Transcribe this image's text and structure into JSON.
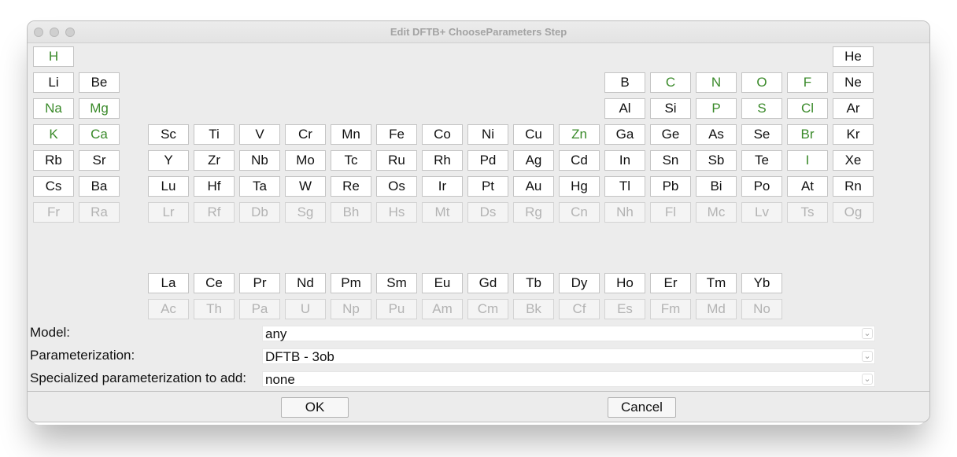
{
  "window": {
    "title": "Edit DFTB+ ChooseParameters Step"
  },
  "colors": {
    "available_element": "#3a8a2a",
    "disabled_element": "#b3b3b3",
    "normal_element": "#111111"
  },
  "periodic_table": {
    "main": [
      [
        "H",
        "",
        "",
        "",
        "",
        "",
        "",
        "",
        "",
        "",
        "",
        "",
        "",
        "",
        "",
        "",
        "",
        "He"
      ],
      [
        "Li",
        "Be",
        "",
        "",
        "",
        "",
        "",
        "",
        "",
        "",
        "",
        "",
        "B",
        "C",
        "N",
        "O",
        "F",
        "Ne"
      ],
      [
        "Na",
        "Mg",
        "",
        "",
        "",
        "",
        "",
        "",
        "",
        "",
        "",
        "",
        "Al",
        "Si",
        "P",
        "S",
        "Cl",
        "Ar"
      ],
      [
        "K",
        "Ca",
        "Sc",
        "Ti",
        "V",
        "Cr",
        "Mn",
        "Fe",
        "Co",
        "Ni",
        "Cu",
        "Zn",
        "Ga",
        "Ge",
        "As",
        "Se",
        "Br",
        "Kr"
      ],
      [
        "Rb",
        "Sr",
        "Y",
        "Zr",
        "Nb",
        "Mo",
        "Tc",
        "Ru",
        "Rh",
        "Pd",
        "Ag",
        "Cd",
        "In",
        "Sn",
        "Sb",
        "Te",
        "I",
        "Xe"
      ],
      [
        "Cs",
        "Ba",
        "Lu",
        "Hf",
        "Ta",
        "W",
        "Re",
        "Os",
        "Ir",
        "Pt",
        "Au",
        "Hg",
        "Tl",
        "Pb",
        "Bi",
        "Po",
        "At",
        "Rn"
      ],
      [
        "Fr",
        "Ra",
        "Lr",
        "Rf",
        "Db",
        "Sg",
        "Bh",
        "Hs",
        "Mt",
        "Ds",
        "Rg",
        "Cn",
        "Nh",
        "Fl",
        "Mc",
        "Lv",
        "Ts",
        "Og"
      ]
    ],
    "lanthanides": [
      "La",
      "Ce",
      "Pr",
      "Nd",
      "Pm",
      "Sm",
      "Eu",
      "Gd",
      "Tb",
      "Dy",
      "Ho",
      "Er",
      "Tm",
      "Yb"
    ],
    "actinides": [
      "Ac",
      "Th",
      "Pa",
      "U",
      "Np",
      "Pu",
      "Am",
      "Cm",
      "Bk",
      "Cf",
      "Es",
      "Fm",
      "Md",
      "No"
    ],
    "available": [
      "H",
      "C",
      "N",
      "O",
      "F",
      "Na",
      "Mg",
      "P",
      "S",
      "Cl",
      "K",
      "Ca",
      "Zn",
      "Br",
      "I"
    ],
    "disabled": [
      "Fr",
      "Ra",
      "Lr",
      "Rf",
      "Db",
      "Sg",
      "Bh",
      "Hs",
      "Mt",
      "Ds",
      "Rg",
      "Cn",
      "Nh",
      "Fl",
      "Mc",
      "Lv",
      "Ts",
      "Og",
      "Ac",
      "Th",
      "Pa",
      "U",
      "Np",
      "Pu",
      "Am",
      "Cm",
      "Bk",
      "Cf",
      "Es",
      "Fm",
      "Md",
      "No"
    ]
  },
  "form": {
    "model": {
      "label": "Model:",
      "value": "any"
    },
    "parameterization": {
      "label": "Parameterization:",
      "value": "DFTB - 3ob"
    },
    "specialized": {
      "label": "Specialized parameterization to add:",
      "value": "none"
    }
  },
  "buttons": {
    "ok": "OK",
    "cancel": "Cancel"
  }
}
